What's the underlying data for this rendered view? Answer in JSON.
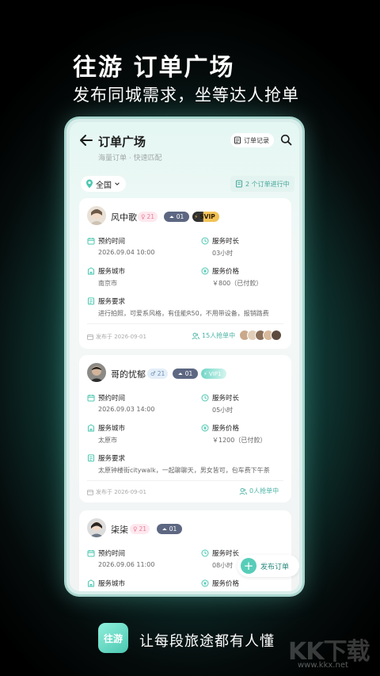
{
  "hero": {
    "title": "往游 订单广场",
    "subtitle": "发布同城需求，坐等达人抢单"
  },
  "screen": {
    "title": "订单广场",
    "subtitle": "海量订单 · 快速匹配",
    "record_button": "订单记录",
    "location_filter": "全国",
    "orders_in_progress": "2 个订单进行中"
  },
  "labels": {
    "appointment_time": "预约时间",
    "service_duration": "服务时长",
    "service_city": "服务城市",
    "service_price": "服务价格",
    "service_requirement": "服务要求",
    "posted_prefix": "发布于",
    "publish_button": "发布订单"
  },
  "orders": [
    {
      "username": "风中歌",
      "gender": "female",
      "age": "21",
      "level": "01",
      "badge": "SVIP",
      "time": "2026.09.04 10:00",
      "duration": "03小时",
      "city": "南京市",
      "price": "￥800（已付款）",
      "requirement": "进行拍照，可爱系风格，有佳能R50，不用带设备，报销路费",
      "posted": "发布于 2026-09-01",
      "grab_count": "15人抢单中"
    },
    {
      "username": "哥的忧郁",
      "gender": "male",
      "age": "21",
      "level": "01",
      "badge": "VIP1",
      "time": "2026.09.03 14:00",
      "duration": "05小时",
      "city": "太原市",
      "price": "￥1200（已付款）",
      "requirement": "太原钟楼街citywalk，一起聊聊天，男女皆可，包车费下午茶",
      "posted": "发布于 2026-09-01",
      "grab_count": "0人抢单中"
    },
    {
      "username": "柒柒",
      "gender": "female",
      "age": "21",
      "level": "01",
      "time": "2026.09.06 11:00",
      "duration": "08小时"
    }
  ],
  "footer": {
    "app_icon_text": "往游",
    "tagline": "让每段旅途都有人懂",
    "watermark": "KK下载",
    "watermark_url": "www.kkx.net"
  },
  "colors": {
    "accent": "#57cdb8",
    "grab_text": "#48b3a5",
    "level_badge": "#5d6782"
  }
}
